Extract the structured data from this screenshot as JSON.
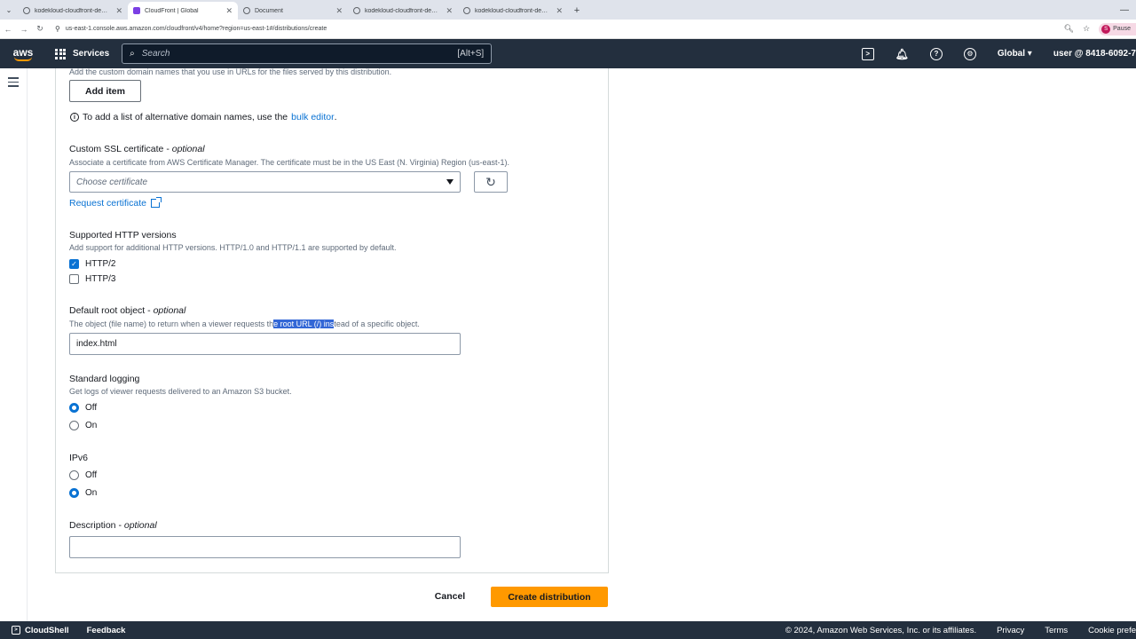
{
  "browser": {
    "tabs": [
      {
        "title": "kodekloud-cloudfront-demo...",
        "active": false
      },
      {
        "title": "CloudFront | Global",
        "active": true
      },
      {
        "title": "Document",
        "active": false
      },
      {
        "title": "kodekloud-cloudfront-demo.s3...",
        "active": false
      },
      {
        "title": "kodekloud-cloudfront-demo.s3...",
        "active": false
      }
    ],
    "url": "us-east-1.console.aws.amazon.com/cloudfront/v4/home?region=us-east-1#/distributions/create",
    "profile_label": "Pause",
    "profile_initial": "S"
  },
  "awsnav": {
    "logo": "aws",
    "services_label": "Services",
    "search_placeholder": "Search",
    "search_shortcut": "[Alt+S]",
    "region": "Global",
    "account": "user @ 8418-6092-7"
  },
  "form": {
    "alt_domain_desc": "Add the custom domain names that you use in URLs for the files served by this distribution.",
    "add_item_label": "Add item",
    "bulk_info_prefix": "To add a list of alternative domain names, use the",
    "bulk_info_link": "bulk editor",
    "bulk_info_suffix": ".",
    "ssl_label": "Custom SSL certificate",
    "ssl_optional": "optional",
    "ssl_desc": "Associate a certificate from AWS Certificate Manager. The certificate must be in the US East (N. Virginia) Region (us-east-1).",
    "ssl_placeholder": "Choose certificate",
    "request_cert_label": "Request certificate",
    "http_label": "Supported HTTP versions",
    "http_desc": "Add support for additional HTTP versions. HTTP/1.0 and HTTP/1.1 are supported by default.",
    "http2_label": "HTTP/2",
    "http2_checked": true,
    "http3_label": "HTTP/3",
    "http3_checked": false,
    "root_label": "Default root object",
    "root_optional": "optional",
    "root_desc_before": "The object (file name) to return when a viewer requests th",
    "root_desc_highlight": "e root URL (/) ins",
    "root_desc_after": "tead of a specific object.",
    "root_value": "index.html",
    "logging_label": "Standard logging",
    "logging_desc": "Get logs of viewer requests delivered to an Amazon S3 bucket.",
    "logging_off": "Off",
    "logging_on": "On",
    "logging_selected": "Off",
    "ipv6_label": "IPv6",
    "ipv6_off": "Off",
    "ipv6_on": "On",
    "ipv6_selected": "On",
    "description_label": "Description",
    "description_optional": "optional",
    "description_value": ""
  },
  "actions": {
    "cancel": "Cancel",
    "create": "Create distribution"
  },
  "footer": {
    "cloudshell": "CloudShell",
    "feedback": "Feedback",
    "copyright": "© 2024, Amazon Web Services, Inc. or its affiliates.",
    "privacy": "Privacy",
    "terms": "Terms",
    "cookie": "Cookie prefe"
  },
  "colors": {
    "accent": "#0972d3",
    "primary_button": "#ff9900",
    "nav_bg": "#232f3e"
  }
}
